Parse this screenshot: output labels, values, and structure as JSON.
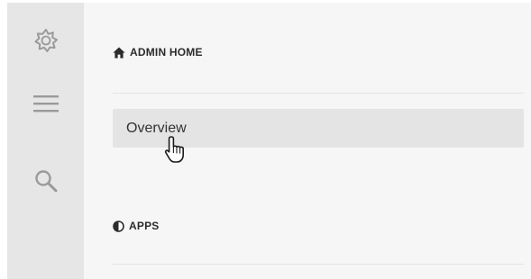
{
  "sidebar": {
    "rail_icons": [
      "gear-icon",
      "menu-icon",
      "search-icon"
    ]
  },
  "nav": {
    "admin_home": {
      "icon": "home-icon",
      "label": "ADMIN HOME",
      "items": [
        {
          "label": "Overview",
          "state": "hover"
        }
      ]
    },
    "apps": {
      "icon": "half-circle-icon",
      "label": "APPS"
    }
  },
  "colors": {
    "rail_bg": "#e6e6e6",
    "panel_bg": "#f6f6f6",
    "hover_bg": "#e4e4e4",
    "icon_gray": "#9a9a9a",
    "text": "#2b2b2b"
  }
}
